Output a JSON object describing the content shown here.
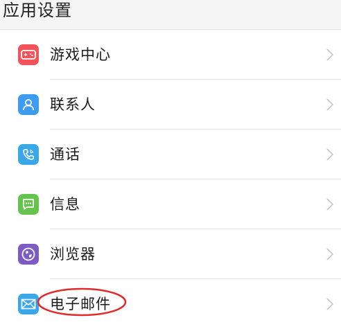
{
  "header": {
    "title": "应用设置"
  },
  "items": [
    {
      "label": "游戏中心",
      "icon": "gamepad-icon",
      "color": "#f2545b"
    },
    {
      "label": "联系人",
      "icon": "contact-person-icon",
      "color": "#3d9bf0"
    },
    {
      "label": "通话",
      "icon": "phone-icon",
      "color": "#3aa7e8"
    },
    {
      "label": "信息",
      "icon": "message-icon",
      "color": "#65c34e"
    },
    {
      "label": "浏览器",
      "icon": "globe-icon",
      "color": "#7c5cc4"
    },
    {
      "label": "电子邮件",
      "icon": "mail-icon",
      "color": "#3aa7e8"
    }
  ],
  "annotation": {
    "highlight_color": "#e02a2a",
    "target": "电子邮件"
  }
}
